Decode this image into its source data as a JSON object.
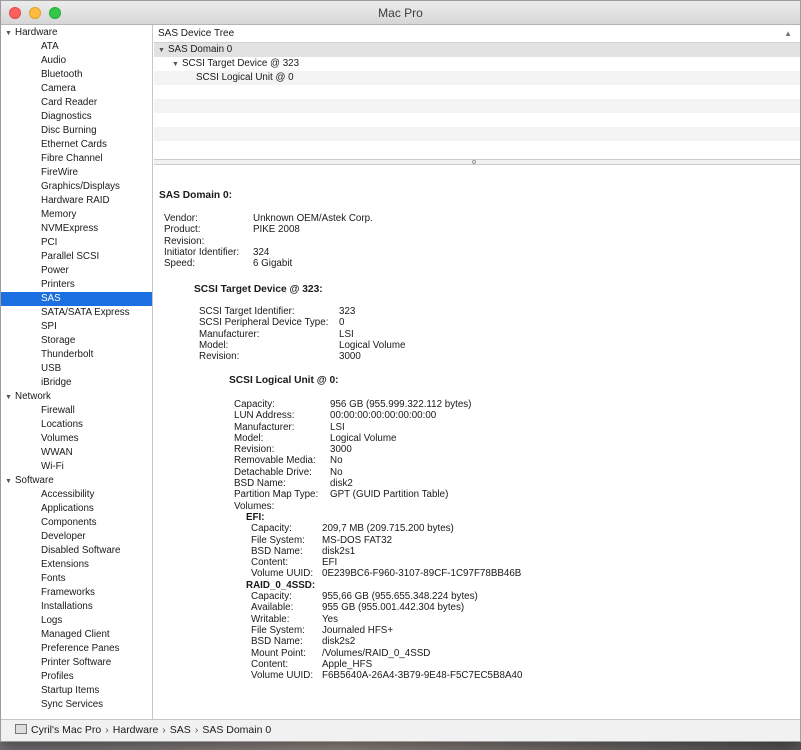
{
  "window": {
    "title": "Mac Pro"
  },
  "sidebar": {
    "groups": [
      {
        "label": "Hardware",
        "items": [
          "ATA",
          "Audio",
          "Bluetooth",
          "Camera",
          "Card Reader",
          "Diagnostics",
          "Disc Burning",
          "Ethernet Cards",
          "Fibre Channel",
          "FireWire",
          "Graphics/Displays",
          "Hardware RAID",
          "Memory",
          "NVMExpress",
          "PCI",
          "Parallel SCSI",
          "Power",
          "Printers",
          "SAS",
          "SATA/SATA Express",
          "SPI",
          "Storage",
          "Thunderbolt",
          "USB",
          "iBridge"
        ]
      },
      {
        "label": "Network",
        "items": [
          "Firewall",
          "Locations",
          "Volumes",
          "WWAN",
          "Wi-Fi"
        ]
      },
      {
        "label": "Software",
        "items": [
          "Accessibility",
          "Applications",
          "Components",
          "Developer",
          "Disabled Software",
          "Extensions",
          "Fonts",
          "Frameworks",
          "Installations",
          "Logs",
          "Managed Client",
          "Preference Panes",
          "Printer Software",
          "Profiles",
          "Startup Items",
          "Sync Services"
        ]
      }
    ],
    "selected": "SAS"
  },
  "tree": {
    "header": "SAS Device Tree",
    "rows": [
      {
        "label": "SAS Domain 0",
        "level": 0,
        "expanded": true
      },
      {
        "label": "SCSI Target Device @ 323",
        "level": 1,
        "expanded": true
      },
      {
        "label": "SCSI Logical Unit @ 0",
        "level": 2,
        "expanded": false
      }
    ]
  },
  "detail": {
    "domain_heading": "SAS Domain 0:",
    "domain_fields": [
      [
        "Vendor:",
        "Unknown OEM/Astek Corp."
      ],
      [
        "Product:",
        "PIKE 2008"
      ],
      [
        "Revision:",
        ""
      ],
      [
        "Initiator Identifier:",
        "324"
      ],
      [
        "Speed:",
        "6 Gigabit"
      ]
    ],
    "target_heading": "SCSI Target Device @ 323:",
    "target_fields": [
      [
        "SCSI Target Identifier:",
        "323"
      ],
      [
        "SCSI Peripheral Device Type:",
        "0"
      ],
      [
        "Manufacturer:",
        "LSI"
      ],
      [
        "Model:",
        "Logical Volume"
      ],
      [
        "Revision:",
        "3000"
      ]
    ],
    "lun_heading": "SCSI Logical Unit @ 0:",
    "lun_fields": [
      [
        "Capacity:",
        "956 GB (955.999.322.112 bytes)"
      ],
      [
        "LUN Address:",
        "00:00:00:00:00:00:00:00"
      ],
      [
        "Manufacturer:",
        "LSI"
      ],
      [
        "Model:",
        "Logical Volume"
      ],
      [
        "Revision:",
        "3000"
      ],
      [
        "Removable Media:",
        "No"
      ],
      [
        "Detachable Drive:",
        "No"
      ],
      [
        "BSD Name:",
        "disk2"
      ],
      [
        "Partition Map Type:",
        "GPT (GUID Partition Table)"
      ],
      [
        "Volumes:",
        ""
      ]
    ],
    "volumes": [
      {
        "name": "EFI:",
        "fields": [
          [
            "Capacity:",
            "209,7 MB (209.715.200 bytes)"
          ],
          [
            "File System:",
            "MS-DOS FAT32"
          ],
          [
            "BSD Name:",
            "disk2s1"
          ],
          [
            "Content:",
            "EFI"
          ],
          [
            "Volume UUID:",
            "0E239BC6-F960-3107-89CF-1C97F78BB46B"
          ]
        ]
      },
      {
        "name": "RAID_0_4SSD:",
        "fields": [
          [
            "Capacity:",
            "955,66 GB (955.655.348.224 bytes)"
          ],
          [
            "Available:",
            "955 GB (955.001.442.304 bytes)"
          ],
          [
            "Writable:",
            "Yes"
          ],
          [
            "File System:",
            "Journaled HFS+"
          ],
          [
            "BSD Name:",
            "disk2s2"
          ],
          [
            "Mount Point:",
            "/Volumes/RAID_0_4SSD"
          ],
          [
            "Content:",
            "Apple_HFS"
          ],
          [
            "Volume UUID:",
            "F6B5640A-26A4-3B79-9E48-F5C7EC5B8A40"
          ]
        ]
      }
    ]
  },
  "statusbar": {
    "path": [
      "Cyril's Mac Pro",
      "Hardware",
      "SAS",
      "SAS Domain 0"
    ]
  },
  "background_peek": [
    "ie",
    "3",
    "S",
    "e",
    "3"
  ]
}
